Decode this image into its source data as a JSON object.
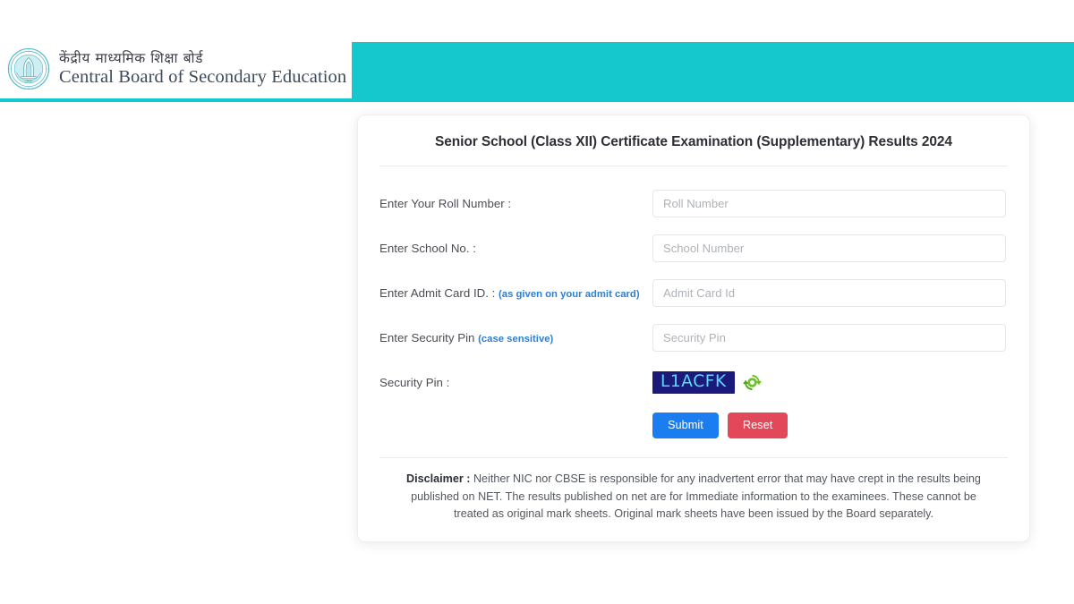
{
  "header": {
    "logo_icon": "cbse-emblem-icon",
    "brand_hindi": "केंद्रीय माध्यमिक शिक्षा बोर्ड",
    "brand_english": "Central Board of Secondary Education",
    "accent_color": "#14c8ce"
  },
  "card": {
    "title": "Senior School (Class XII) Certificate Examination (Supplementary) Results 2024",
    "fields": [
      {
        "label": "Enter Your Roll Number :",
        "hint": "",
        "placeholder": "Roll Number",
        "value": "",
        "name": "roll-number"
      },
      {
        "label": "Enter School No. :",
        "hint": "",
        "placeholder": "School Number",
        "value": "",
        "name": "school-number"
      },
      {
        "label": "Enter Admit Card ID. :",
        "hint": "(as given on your admit card)",
        "placeholder": "Admit Card Id",
        "value": "",
        "name": "admit-card-id"
      },
      {
        "label": "Enter Security Pin",
        "hint": "(case sensitive)",
        "placeholder": "Security Pin",
        "value": "",
        "name": "security-pin"
      }
    ],
    "captcha": {
      "label": "Security Pin :",
      "code": "L1ACFK",
      "background_color": "#1a1a7a",
      "text_color": "#5fd6ff",
      "refresh_icon": "refresh-icon",
      "refresh_icon_color": "#4caf2a"
    },
    "buttons": {
      "submit_label": "Submit",
      "submit_color": "#1a7ef0",
      "reset_label": "Reset",
      "reset_color": "#e3485a"
    },
    "disclaimer": {
      "heading": "Disclaimer :",
      "text": " Neither NIC nor CBSE is responsible for any inadvertent error that may have crept in the results being published on NET. The results published on net are for Immediate information to the examinees. These cannot be treated as original mark sheets. Original mark sheets have been issued by the Board separately."
    }
  }
}
